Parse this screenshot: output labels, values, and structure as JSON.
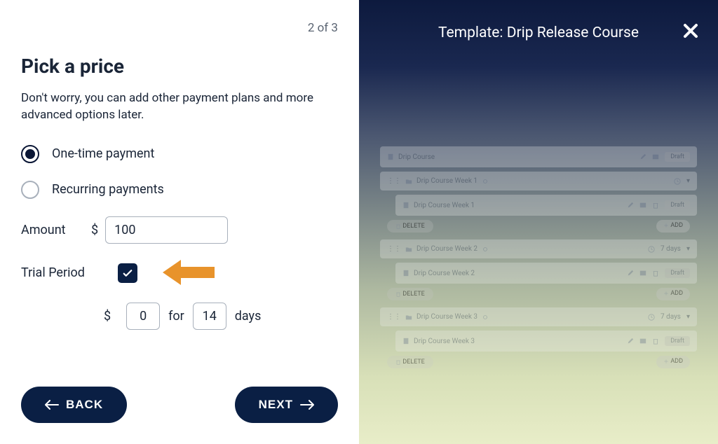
{
  "step": "2 of 3",
  "title": "Pick a price",
  "subtitle": "Don't worry, you can add other payment plans and more advanced options later.",
  "options": {
    "onetime": "One-time payment",
    "recurring": "Recurring payments"
  },
  "amount": {
    "label": "Amount",
    "currency": "$",
    "value": "100"
  },
  "trial": {
    "label": "Trial Period",
    "checked": true,
    "currency": "$",
    "price": "0",
    "for": "for",
    "days_value": "14",
    "days_label": "days"
  },
  "buttons": {
    "back": "BACK",
    "next": "NEXT"
  },
  "preview": {
    "title": "Template: Drip Release Course",
    "items": [
      {
        "label": "Drip Course",
        "type": "root",
        "badge": "Draft"
      },
      {
        "label": "Drip Course Week 1",
        "type": "section",
        "timer": ""
      },
      {
        "label": "Drip Course Week 1",
        "type": "lesson",
        "badge": "Draft"
      },
      {
        "label": "Drip Course Week 2",
        "type": "section",
        "timer": "7 days"
      },
      {
        "label": "Drip Course Week 2",
        "type": "lesson",
        "badge": "Draft"
      },
      {
        "label": "Drip Course Week 3",
        "type": "section",
        "timer": "7 days"
      },
      {
        "label": "Drip Course Week 3",
        "type": "lesson",
        "badge": "Draft"
      }
    ],
    "delete_label": "DELETE",
    "add_label": "ADD"
  }
}
